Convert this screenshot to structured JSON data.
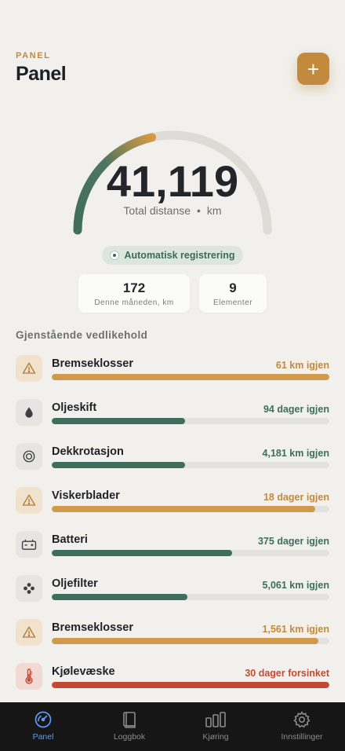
{
  "header": {
    "eyebrow": "PANEL",
    "title": "Panel",
    "add_label": "+"
  },
  "gauge": {
    "value": "41,119",
    "label": "Total distanse",
    "separator": "•",
    "unit": "km",
    "progress": 0.43,
    "colors": {
      "start": "#3f6d5e",
      "end": "#d59a45",
      "track": "#dcdbd5"
    }
  },
  "auto_pill": {
    "label": "Automatisk registrering"
  },
  "stats": [
    {
      "value": "172",
      "label": "Denne måneden, km"
    },
    {
      "value": "9",
      "label": "Elementer"
    }
  ],
  "section_title": "Gjenstående vedlikehold",
  "maintenance": [
    {
      "name": "Bremseklosser",
      "status": "61 km igjen",
      "icon": "warning-icon",
      "tone": "warn",
      "progress": 1.0
    },
    {
      "name": "Oljeskift",
      "status": "94 dager igjen",
      "icon": "oil-drop-icon",
      "tone": "ok",
      "progress": 0.48
    },
    {
      "name": "Dekkrotasjon",
      "status": "4,181 km igjen",
      "icon": "tire-icon",
      "tone": "ok",
      "progress": 0.48
    },
    {
      "name": "Viskerblader",
      "status": "18 dager igjen",
      "icon": "warning-icon",
      "tone": "warn",
      "progress": 0.95
    },
    {
      "name": "Batteri",
      "status": "375 dager igjen",
      "icon": "battery-icon",
      "tone": "ok",
      "progress": 0.65
    },
    {
      "name": "Oljefilter",
      "status": "5,061 km igjen",
      "icon": "filter-icon",
      "tone": "ok",
      "progress": 0.49
    },
    {
      "name": "Bremseklosser",
      "status": "1,561 km igjen",
      "icon": "warning-icon",
      "tone": "warn",
      "progress": 0.96
    },
    {
      "name": "Kjølevæske",
      "status": "30 dager forsinket",
      "icon": "thermometer-icon",
      "tone": "late",
      "progress": 1.0
    }
  ],
  "tones": {
    "warn": {
      "text": "#c08a3e",
      "bar": "#cf9a4c",
      "icon_bg": "#f0e2cc",
      "icon_fg": "#b07a30"
    },
    "ok": {
      "text": "#3f6d5e",
      "bar": "#3f6d5e",
      "icon_bg": "#e6e5e1",
      "icon_fg": "#3d4044"
    },
    "late": {
      "text": "#c24a34",
      "bar": "#c24a34",
      "icon_bg": "#f2d9d3",
      "icon_fg": "#c24a34"
    }
  },
  "tabs": [
    {
      "label": "Panel",
      "icon": "speedometer-icon",
      "active": true
    },
    {
      "label": "Loggbok",
      "icon": "book-icon",
      "active": false
    },
    {
      "label": "Kjøring",
      "icon": "bars-chart-icon",
      "active": false
    },
    {
      "label": "Innstillinger",
      "icon": "gear-icon",
      "active": false
    }
  ]
}
